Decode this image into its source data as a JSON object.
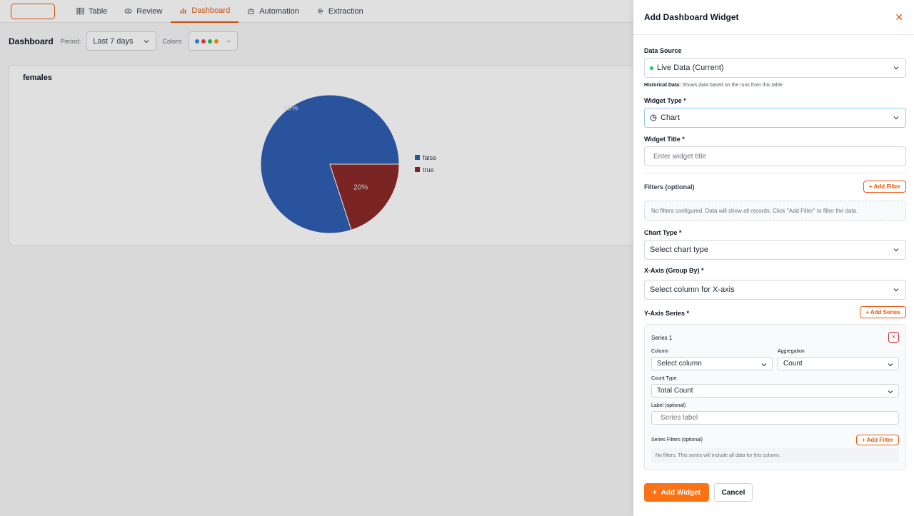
{
  "nav": {
    "tabs": [
      {
        "label": "Table",
        "icon": "table-icon"
      },
      {
        "label": "Review",
        "icon": "eye-icon"
      },
      {
        "label": "Dashboard",
        "icon": "bar-chart-icon",
        "active": true
      },
      {
        "label": "Automation",
        "icon": "bot-icon"
      },
      {
        "label": "Extraction",
        "icon": "gear-icon"
      }
    ]
  },
  "toolbar": {
    "title": "Dashboard",
    "period_label": "Period:",
    "period_value": "Last 7 days",
    "colors_label": "Colors:",
    "color_dots": [
      "#3b82f6",
      "#ef4444",
      "#22c55e",
      "#f59e0b"
    ]
  },
  "widget": {
    "title": "females",
    "chart_data": {
      "type": "pie",
      "title": "females",
      "labels": [
        "false",
        "true"
      ],
      "values": [
        80,
        20
      ],
      "value_labels": [
        "80%",
        "20%"
      ],
      "colors": [
        "#2f5fb3",
        "#8b2a2a"
      ],
      "legend_position": "right"
    }
  },
  "panel": {
    "title": "Add Dashboard Widget",
    "data_source": {
      "label": "Data Source",
      "value": "Live Data (Current)",
      "status_color": "#22c55e",
      "hint_bold": "Historical Data:",
      "hint_text": " Shows data based on the runs from this table."
    },
    "widget_type": {
      "label": "Widget Type *",
      "value": "Chart"
    },
    "widget_title": {
      "label": "Widget Title *",
      "placeholder": "Enter widget title"
    },
    "filters": {
      "label": "Filters (optional)",
      "add_label": "+ Add Filter",
      "empty_text": "No filters configured. Data will show all records. Click \"Add Filter\" to filter the data."
    },
    "chart_type": {
      "label": "Chart Type *",
      "value": "Select chart type"
    },
    "x_axis": {
      "label": "X-Axis (Group By) *",
      "value": "Select column for X-axis"
    },
    "y_axis": {
      "label": "Y-Axis Series *",
      "add_label": "+ Add Series",
      "series": {
        "name": "Series 1",
        "close_label": "×",
        "column_label": "Column",
        "column_value": "Select column",
        "aggregation_label": "Aggregation",
        "aggregation_value": "Count",
        "count_type_label": "Count Type",
        "count_type_value": "Total Count",
        "label_label": "Label (optional)",
        "label_placeholder": "Series label",
        "filters_label": "Series Filters (optional)",
        "filters_add_label": "+ Add Filter",
        "filters_empty": "No filters. This series will include all data for this column."
      }
    },
    "buttons": {
      "primary": "Add Widget",
      "primary_icon": "+",
      "secondary": "Cancel"
    }
  }
}
